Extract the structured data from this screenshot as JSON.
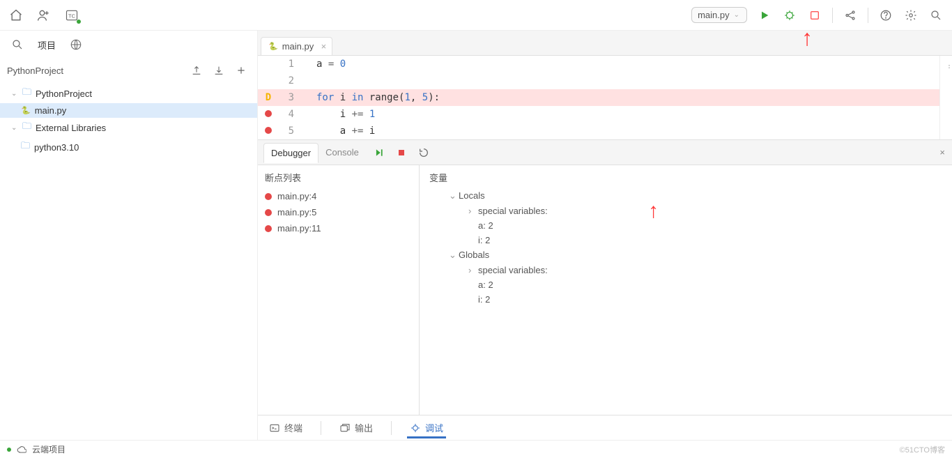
{
  "toolbar": {
    "run_config_label": "main.py"
  },
  "sidebar": {
    "tab_project_label": "项目",
    "project_root": "PythonProject",
    "tree": {
      "root_folder": "PythonProject",
      "file": "main.py",
      "ext_libs": "External Libraries",
      "python_env": "python3.10"
    }
  },
  "editor": {
    "tab_label": "main.py",
    "lines": [
      {
        "n": "1",
        "html": "a <span class='eq'>=</span> <span class='num'>0</span>",
        "marker": ""
      },
      {
        "n": "2",
        "html": "",
        "marker": ""
      },
      {
        "n": "3",
        "html": "<span class='kw'>for</span> i <span class='kw'>in</span> range(<span class='num'>1</span>, <span class='num'>5</span>):",
        "marker": "D",
        "highlight": true
      },
      {
        "n": "4",
        "html": "    i <span class='eq'>+=</span> <span class='num'>1</span>",
        "marker": "bp"
      },
      {
        "n": "5",
        "html": "    a <span class='eq'>+=</span> i",
        "marker": "bp"
      }
    ]
  },
  "debug": {
    "tab_debugger": "Debugger",
    "tab_console": "Console",
    "breakpoints_title": "断点列表",
    "breakpoints": [
      "main.py:4",
      "main.py:5",
      "main.py:11"
    ],
    "variables_title": "变量",
    "vars": {
      "locals_label": "Locals",
      "globals_label": "Globals",
      "specials_label": "special variables:",
      "a_label": "a: 2",
      "i_label": "i: 2"
    }
  },
  "bottom_tabs": {
    "terminal": "终端",
    "output": "输出",
    "debug": "调试"
  },
  "status": {
    "cloud_label": "云端项目",
    "watermark": "©51CTO博客"
  }
}
